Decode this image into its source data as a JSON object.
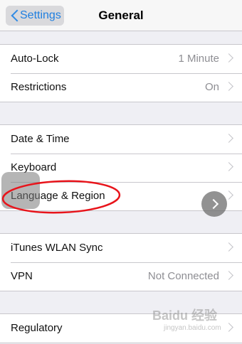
{
  "navbar": {
    "back_label": "Settings",
    "title": "General"
  },
  "groups": [
    {
      "rows": [
        {
          "label": "Auto-Lock",
          "value": "1 Minute"
        },
        {
          "label": "Restrictions",
          "value": "On"
        }
      ]
    },
    {
      "rows": [
        {
          "label": "Date & Time",
          "value": ""
        },
        {
          "label": "Keyboard",
          "value": ""
        },
        {
          "label": "Language & Region",
          "value": ""
        }
      ]
    },
    {
      "rows": [
        {
          "label": "iTunes WLAN Sync",
          "value": ""
        },
        {
          "label": "VPN",
          "value": "Not Connected"
        }
      ]
    },
    {
      "rows": [
        {
          "label": "Regulatory",
          "value": ""
        }
      ]
    }
  ],
  "watermark": {
    "logo": "Baidu 经验",
    "url": "jingyan.baidu.com"
  },
  "colors": {
    "accent": "#1f7fe0",
    "annotation": "#e8141b",
    "background": "#efeff4"
  }
}
